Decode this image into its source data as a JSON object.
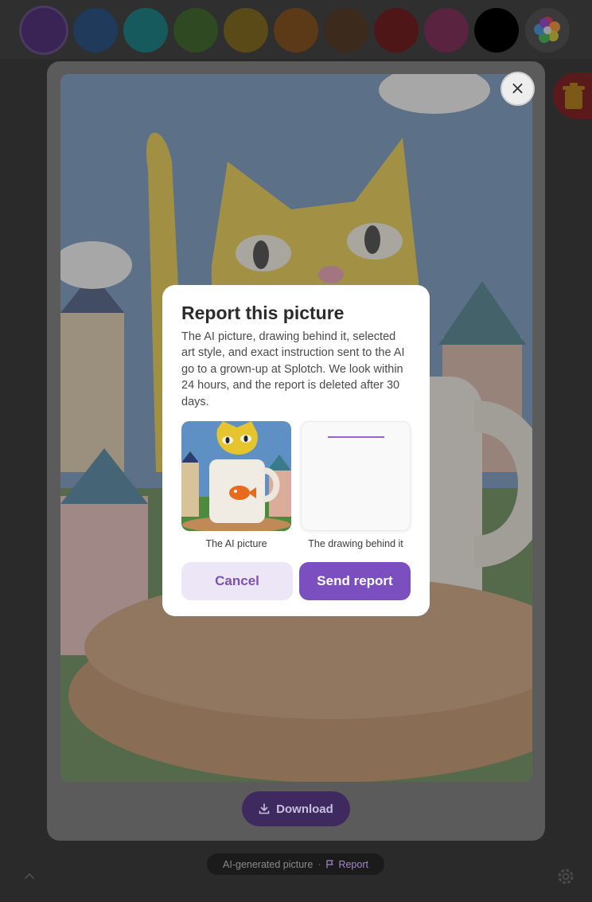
{
  "palette": {
    "swatches": [
      {
        "name": "purple",
        "color": "#3a2456",
        "selected": true
      },
      {
        "name": "navy",
        "color": "#1f3a5a"
      },
      {
        "name": "teal",
        "color": "#175a5d"
      },
      {
        "name": "green",
        "color": "#2f4a22"
      },
      {
        "name": "yellow",
        "color": "#5a4a18"
      },
      {
        "name": "orange",
        "color": "#5c3a18"
      },
      {
        "name": "brown",
        "color": "#3c2a1c"
      },
      {
        "name": "red",
        "color": "#4e1616"
      },
      {
        "name": "pink",
        "color": "#5a2340"
      },
      {
        "name": "black",
        "color": "#000000"
      }
    ],
    "rainbow_icon": "flower-icon"
  },
  "viewer": {
    "close_icon": "×",
    "download_label": "Download"
  },
  "footer": {
    "badge_label": "AI-generated picture",
    "separator": "·",
    "report_label": "Report"
  },
  "modal": {
    "title": "Report this picture",
    "body": "The AI picture, drawing behind it, selected art style, and exact instruction sent to the AI go to a grown-up at Splotch. We look within 24 hours, and the report is deleted after 30 days.",
    "ai_caption": "The AI picture",
    "drawing_caption": "The drawing behind it",
    "cancel_label": "Cancel",
    "send_label": "Send report"
  },
  "colors": {
    "accent": "#7b4fbf",
    "accent_soft": "#ece6f6",
    "overlay": "rgba(0,0,0,0.55)"
  }
}
